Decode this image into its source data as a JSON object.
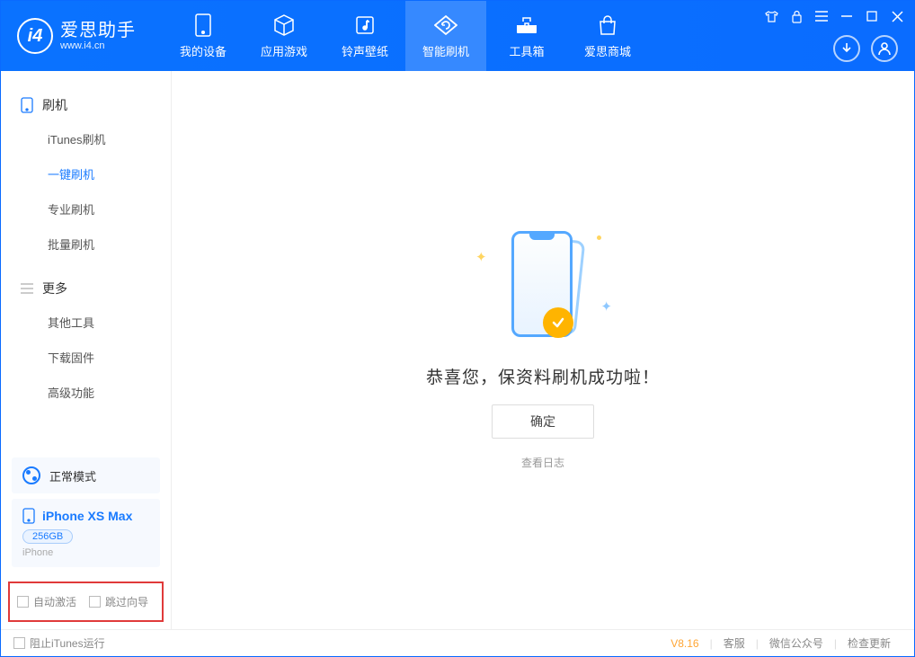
{
  "app": {
    "title": "爱思助手",
    "subtitle": "www.i4.cn"
  },
  "nav": {
    "tabs": [
      {
        "label": "我的设备",
        "icon": "phone-icon"
      },
      {
        "label": "应用游戏",
        "icon": "cube-icon"
      },
      {
        "label": "铃声壁纸",
        "icon": "music-icon"
      },
      {
        "label": "智能刷机",
        "icon": "refresh-icon",
        "active": true
      },
      {
        "label": "工具箱",
        "icon": "toolbox-icon"
      },
      {
        "label": "爱思商城",
        "icon": "bag-icon"
      }
    ]
  },
  "sidebar": {
    "group1": {
      "label": "刷机",
      "items": [
        {
          "label": "iTunes刷机"
        },
        {
          "label": "一键刷机",
          "active": true
        },
        {
          "label": "专业刷机"
        },
        {
          "label": "批量刷机"
        }
      ]
    },
    "group2": {
      "label": "更多",
      "items": [
        {
          "label": "其他工具"
        },
        {
          "label": "下载固件"
        },
        {
          "label": "高级功能"
        }
      ]
    },
    "mode": {
      "label": "正常模式"
    },
    "device": {
      "name": "iPhone XS Max",
      "storage": "256GB",
      "type": "iPhone"
    },
    "checks": {
      "auto_activate": "自动激活",
      "skip_guide": "跳过向导"
    }
  },
  "main": {
    "success_msg": "恭喜您，保资料刷机成功啦！",
    "ok_btn": "确定",
    "log_link": "查看日志"
  },
  "footer": {
    "block_itunes": "阻止iTunes运行",
    "version": "V8.16",
    "support": "客服",
    "wechat": "微信公众号",
    "update": "检查更新"
  }
}
